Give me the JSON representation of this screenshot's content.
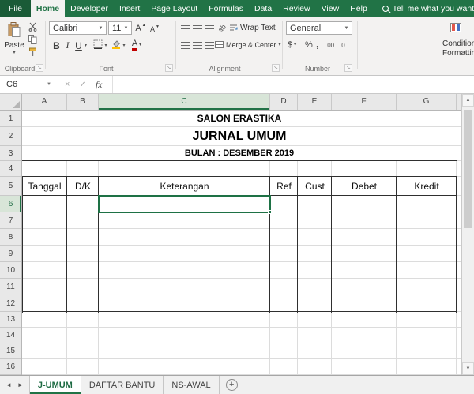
{
  "titlebar": {
    "tabs": [
      "File",
      "Home",
      "Developer",
      "Insert",
      "Page Layout",
      "Formulas",
      "Data",
      "Review",
      "View",
      "Help"
    ],
    "active_tab": "Home",
    "search_placeholder": "Tell me what you want to"
  },
  "ribbon": {
    "clipboard": {
      "label": "Clipboard",
      "paste_label": "Paste"
    },
    "font": {
      "label": "Font",
      "family": "Calibri",
      "size": "11",
      "bold": "B",
      "italic": "I",
      "underline": "U",
      "letter": "A"
    },
    "alignment": {
      "label": "Alignment",
      "wrap_text": "Wrap Text",
      "merge_center": "Merge & Center",
      "orientation": "ab"
    },
    "number": {
      "label": "Number",
      "format": "General",
      "accounting": "$",
      "percent": "%",
      "comma": ",",
      "increase_decimal": ".00",
      "decrease_decimal": ".0"
    },
    "styles": {
      "conditional_formatting_line1": "Conditional",
      "conditional_formatting_line2": "Formatting"
    }
  },
  "formula_bar": {
    "name_box": "C6",
    "cancel": "×",
    "enter": "✓",
    "fx": "fx"
  },
  "grid": {
    "columns": [
      "A",
      "B",
      "C",
      "D",
      "E",
      "F",
      "G"
    ],
    "rows": [
      "1",
      "2",
      "3",
      "4",
      "5",
      "6",
      "7",
      "8",
      "9",
      "10",
      "11",
      "12",
      "13",
      "14",
      "15",
      "16"
    ],
    "active_cell": "C6",
    "title1": "SALON ERASTIKA",
    "title2": "JURNAL UMUM",
    "title3": "BULAN : DESEMBER 2019",
    "table_headers": [
      "Tanggal",
      "D/K",
      "Keterangan",
      "Ref",
      "Cust",
      "Debet",
      "Kredit"
    ]
  },
  "sheet_tabs": {
    "tabs": [
      "J-UMUM",
      "DAFTAR BANTU",
      "NS-AWAL"
    ],
    "active": "J-UMUM",
    "add_label": "+"
  }
}
